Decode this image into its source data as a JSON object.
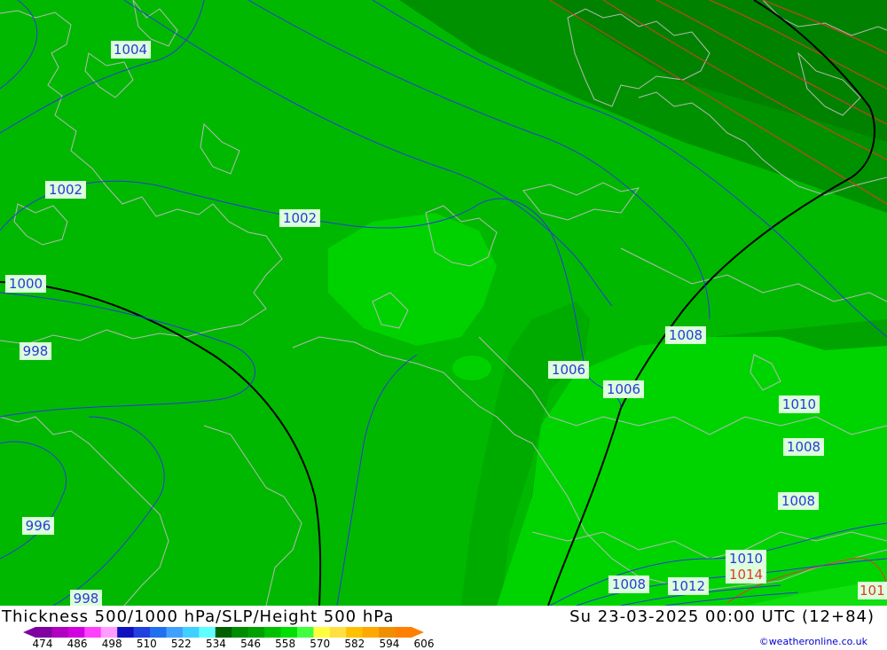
{
  "title": "Thickness 500/1000 hPa/SLP/Height 500 hPa",
  "datetime": "Su 23-03-2025 00:00 UTC (12+84)",
  "credit": "©weatheronline.co.uk",
  "legend": {
    "ticks": [
      "474",
      "486",
      "498",
      "510",
      "522",
      "534",
      "546",
      "558",
      "570",
      "582",
      "594",
      "606"
    ],
    "colors": [
      "#8000a0",
      "#b000c0",
      "#d000e0",
      "#ff40ff",
      "#ff9cff",
      "#1010c0",
      "#2040e0",
      "#2070f0",
      "#40a0ff",
      "#40d0ff",
      "#60ffff",
      "#006000",
      "#008c00",
      "#00a000",
      "#00c000",
      "#00e000",
      "#40ff40",
      "#ffff40",
      "#ffe040",
      "#ffc000",
      "#ffa800",
      "#f09000",
      "#ff8000"
    ]
  },
  "isobar_labels": {
    "l1004": "1004",
    "l1002a": "1002",
    "l1002b": "1002",
    "l1000": "1000",
    "l998a": "998",
    "l998b": "998",
    "l996": "996",
    "l1006a": "1006",
    "l1006b": "1006",
    "l1008a": "1008",
    "l1008b": "1008",
    "l1008c": "1008",
    "l1008d": "1008",
    "l1010a": "1010",
    "l1010b": "1010",
    "l1012": "1012",
    "l1014": "1014",
    "l101": "101"
  }
}
